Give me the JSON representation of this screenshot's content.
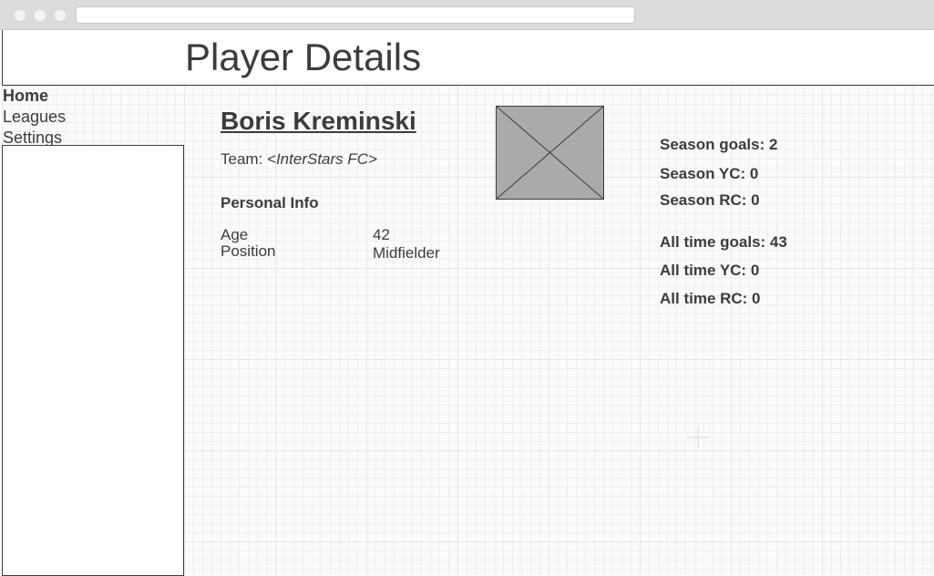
{
  "header": {
    "title": "Player Details"
  },
  "nav": {
    "items": [
      "Home",
      "Leagues",
      "Settings"
    ]
  },
  "player": {
    "name": "Boris Kreminski",
    "team_label": "Team:",
    "team_value": "<InterStars FC>",
    "personal_info_title": "Personal Info",
    "personal_info": [
      {
        "label": "Age",
        "value": "42"
      },
      {
        "label": "Position",
        "value": "Midfielder"
      }
    ]
  },
  "stats": {
    "season_goals": "Season goals: 2",
    "season_yc": "Season YC: 0",
    "season_rc": "Season RC: 0",
    "alltime_goals": "All time goals: 43",
    "alltime_yc": "All time YC: 0",
    "alltime_rc": "All time RC: 0"
  },
  "colors": {
    "text": "#3c3c3c",
    "photo_fill": "#aaaaaa",
    "chrome": "#dcdcdc"
  },
  "icons": {
    "photo": "image-placeholder-icon"
  }
}
